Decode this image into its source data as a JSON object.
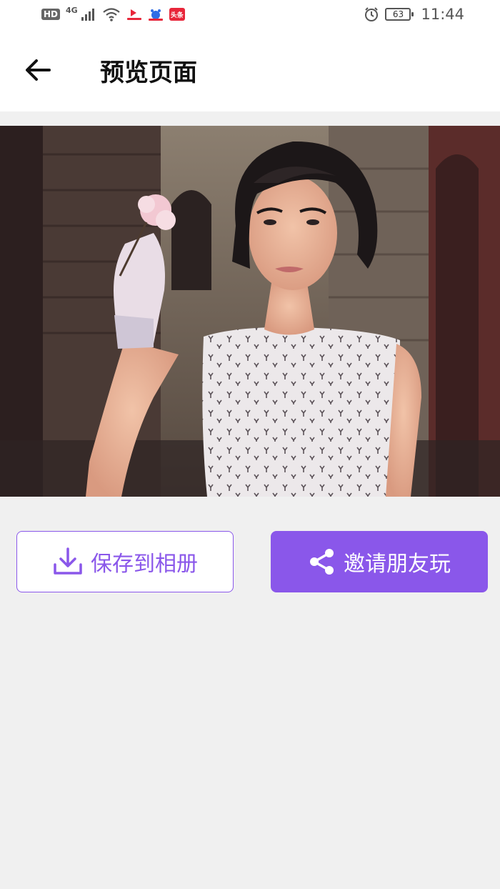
{
  "status_bar": {
    "hd_label": "HD",
    "network_label": "4G",
    "app_badge_3_text": "头条",
    "battery_level": "63",
    "time": "11:44"
  },
  "header": {
    "title": "预览页面"
  },
  "actions": {
    "save_label": "保存到相册",
    "share_label": "邀请朋友玩"
  },
  "colors": {
    "accent": "#8a57ea",
    "background": "#f0f0f0",
    "header_bg": "#ffffff"
  },
  "icons": {
    "back": "arrow-left-icon",
    "save": "download-icon",
    "share": "share-icon",
    "alarm": "alarm-icon",
    "wifi": "wifi-icon",
    "signal": "signal-icon"
  }
}
